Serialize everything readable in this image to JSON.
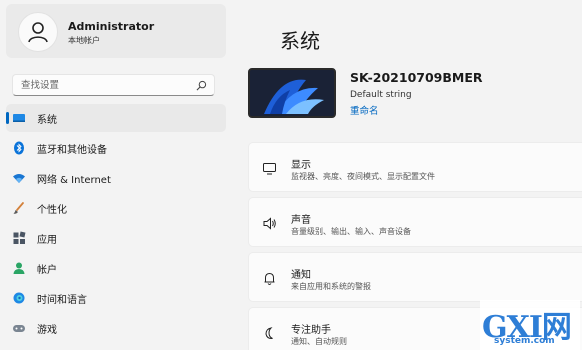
{
  "account": {
    "name": "Administrator",
    "type": "本地帐户"
  },
  "search": {
    "placeholder": "查找设置"
  },
  "nav": [
    {
      "label": "系统",
      "icon": "monitor-icon",
      "active": true
    },
    {
      "label": "蓝牙和其他设备",
      "icon": "bluetooth-icon"
    },
    {
      "label": "网络 & Internet",
      "icon": "wifi-icon"
    },
    {
      "label": "个性化",
      "icon": "brush-icon"
    },
    {
      "label": "应用",
      "icon": "apps-icon"
    },
    {
      "label": "帐户",
      "icon": "person-icon"
    },
    {
      "label": "时间和语言",
      "icon": "globe-icon"
    },
    {
      "label": "游戏",
      "icon": "gamepad-icon"
    }
  ],
  "page": {
    "title": "系统"
  },
  "device": {
    "name": "SK-20210709BMER",
    "description": "Default string",
    "rename": "重命名"
  },
  "cards": [
    {
      "title": "显示",
      "subtitle": "监视器、亮度、夜间模式、显示配置文件",
      "icon": "display-icon"
    },
    {
      "title": "声音",
      "subtitle": "音量级别、输出、输入、声音设备",
      "icon": "speaker-icon"
    },
    {
      "title": "通知",
      "subtitle": "来自应用和系统的警报",
      "icon": "bell-icon"
    },
    {
      "title": "专注助手",
      "subtitle": "通知、自动规则",
      "icon": "moon-icon"
    }
  ],
  "watermark": {
    "main": "GXI网",
    "url": "system.com"
  },
  "colors": {
    "accent": "#0067c0",
    "background": "#f3f3f3",
    "card": "#fbfbfb"
  }
}
